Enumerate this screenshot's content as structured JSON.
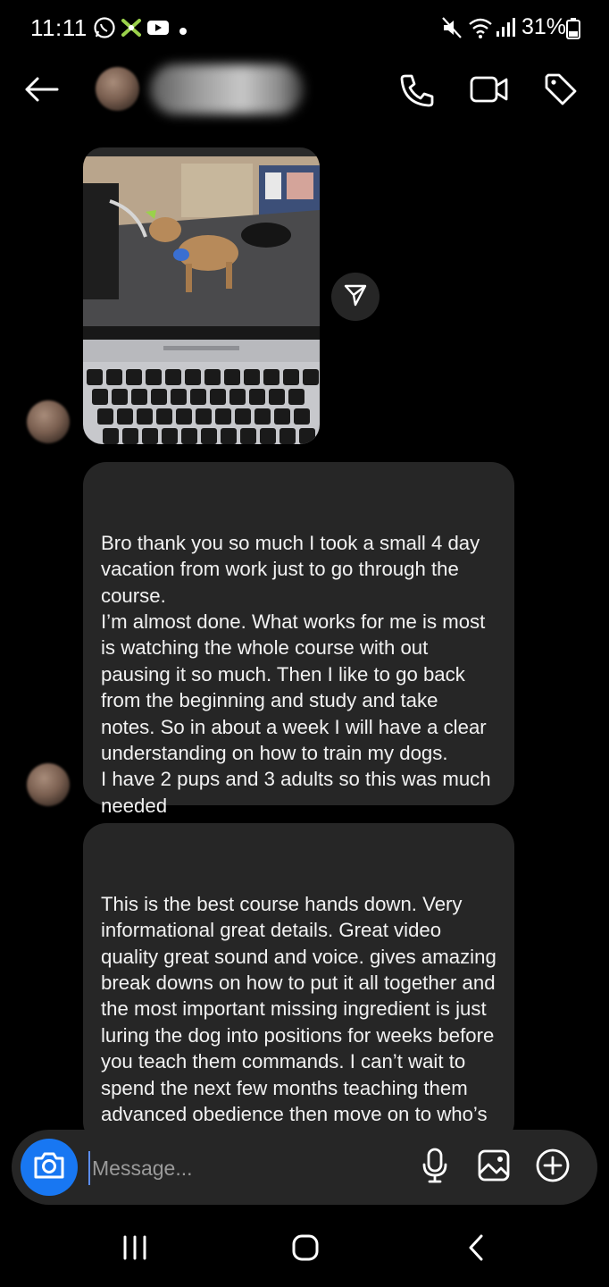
{
  "status_bar": {
    "time": "11:11",
    "battery": "31%",
    "icons": [
      "whatsapp-icon",
      "app-notification-icon",
      "youtube-icon",
      "dot-icon",
      "mute-icon",
      "wifi-icon",
      "signal-icon",
      "battery-icon"
    ]
  },
  "header": {
    "back_icon": "arrow-left-icon",
    "call_icon": "phone-icon",
    "video_icon": "video-camera-icon",
    "tag_icon": "tag-icon"
  },
  "messages": [
    {
      "type": "photo",
      "description_icon": "photo-laptop-dog-training"
    },
    {
      "type": "text",
      "text": "Bro thank you so much I took a small 4 day vacation from work just to go through the course.\nI’m almost done. What works for me is most is watching the whole course with out pausing it so much. Then I like to go back from the beginning and study and take notes. So in about a week I will have a clear understanding on how to train my dogs.\nI have 2 pups and 3 adults so this was much needed"
    },
    {
      "type": "text",
      "text": "This is the best course hands down. Very informational great details. Great video quality great sound and voice. gives amazing break downs on how to put it all together and the most important missing ingredient is just luring the dog into positions for weeks before you teach them commands. I can’t wait to spend the next few months teaching them advanced obedience then move on to who’s a contender for personal protection. All the"
    }
  ],
  "composer": {
    "placeholder": "Message...",
    "camera_icon": "camera-icon",
    "mic_icon": "microphone-icon",
    "gallery_icon": "image-icon",
    "plus_icon": "plus-circle-icon"
  },
  "nav_bar": {
    "recents_icon": "recents-icon",
    "home_icon": "home-icon",
    "back_icon": "chevron-left-icon"
  },
  "colors": {
    "background": "#000000",
    "bubble": "#262626",
    "accent": "#1877f2"
  }
}
